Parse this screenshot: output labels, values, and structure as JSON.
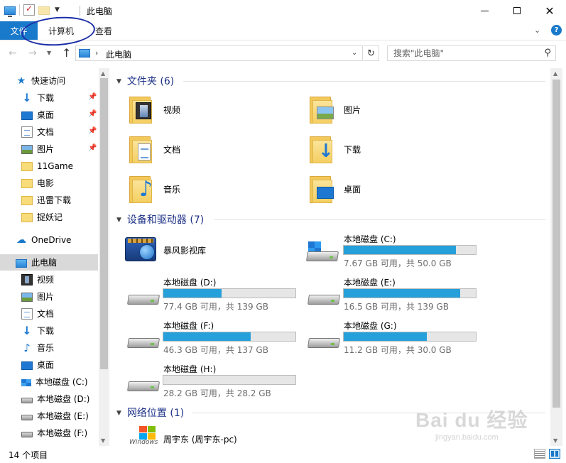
{
  "window": {
    "title": "此电脑"
  },
  "ribbon": {
    "tabs": [
      {
        "label": "文件",
        "active": true
      },
      {
        "label": "计算机"
      },
      {
        "label": "查看"
      }
    ],
    "help": "?"
  },
  "address": {
    "path": "此电脑",
    "search_placeholder": "搜索\"此电脑\""
  },
  "nav": {
    "quick_access": "快速访问",
    "quick_items": [
      {
        "label": "下载",
        "icon": "download-icon",
        "pinned": true
      },
      {
        "label": "桌面",
        "icon": "desktop-icon",
        "pinned": true
      },
      {
        "label": "文档",
        "icon": "document-icon",
        "pinned": true
      },
      {
        "label": "图片",
        "icon": "picture-icon",
        "pinned": true
      },
      {
        "label": "11Game",
        "icon": "folder-icon"
      },
      {
        "label": "电影",
        "icon": "folder-icon"
      },
      {
        "label": "迅雷下载",
        "icon": "folder-icon"
      },
      {
        "label": "捉妖记",
        "icon": "folder-icon"
      }
    ],
    "onedrive": "OneDrive",
    "this_pc": "此电脑",
    "pc_items": [
      {
        "label": "视频",
        "icon": "video-icon"
      },
      {
        "label": "图片",
        "icon": "picture-icon"
      },
      {
        "label": "文档",
        "icon": "document-icon"
      },
      {
        "label": "下载",
        "icon": "download-icon"
      },
      {
        "label": "音乐",
        "icon": "music-icon"
      },
      {
        "label": "桌面",
        "icon": "desktop-icon"
      },
      {
        "label": "本地磁盘 (C:)",
        "icon": "windows-drive-icon"
      },
      {
        "label": "本地磁盘 (D:)",
        "icon": "drive-icon"
      },
      {
        "label": "本地磁盘 (E:)",
        "icon": "drive-icon"
      },
      {
        "label": "本地磁盘 (F:)",
        "icon": "drive-icon"
      }
    ]
  },
  "content": {
    "folders_header": "文件夹 (6)",
    "folders": [
      {
        "label": "视频",
        "icon": "video-folder-icon"
      },
      {
        "label": "图片",
        "icon": "picture-folder-icon"
      },
      {
        "label": "文档",
        "icon": "document-folder-icon"
      },
      {
        "label": "下载",
        "icon": "download-folder-icon"
      },
      {
        "label": "音乐",
        "icon": "music-folder-icon"
      },
      {
        "label": "桌面",
        "icon": "desktop-folder-icon"
      }
    ],
    "devices_header": "设备和驱动器 (7)",
    "media_library": "暴风影视库",
    "drives": [
      {
        "name": "本地磁盘 (C:)",
        "free": "7.67 GB 可用，共 50.0 GB",
        "used_fraction": 0.847
      },
      {
        "name": "本地磁盘 (D:)",
        "free": "77.4 GB 可用，共 139 GB",
        "used_fraction": 0.443
      },
      {
        "name": "本地磁盘 (E:)",
        "free": "16.5 GB 可用，共 139 GB",
        "used_fraction": 0.881
      },
      {
        "name": "本地磁盘 (F:)",
        "free": "46.3 GB 可用，共 137 GB",
        "used_fraction": 0.662
      },
      {
        "name": "本地磁盘 (G:)",
        "free": "11.2 GB 可用，共 30.0 GB",
        "used_fraction": 0.627
      },
      {
        "name": "本地磁盘 (H:)",
        "free": "28.2 GB 可用，共 28.2 GB",
        "used_fraction": 0.0
      }
    ],
    "network_header": "网络位置 (1)",
    "network_item": "周宇东 (周宇东-pc)",
    "network_logo_text": "Windows"
  },
  "status": {
    "count": "14 个项目"
  },
  "watermark": {
    "brand": "Bai du 经验",
    "url": "jingyan.baidu.com"
  },
  "colors": {
    "accent": "#1979ca",
    "bar_fill": "#26a0da",
    "header_text": "#1e3287"
  }
}
